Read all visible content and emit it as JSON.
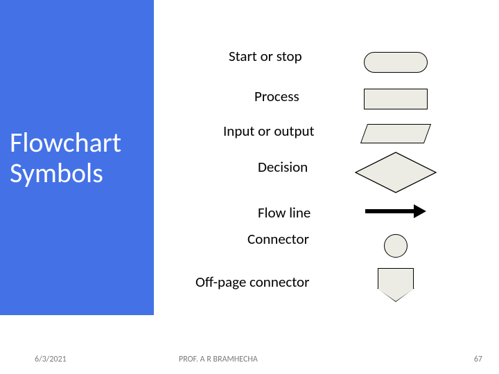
{
  "sidebar": {
    "title_line1": "Flowchart",
    "title_line2": "Symbols"
  },
  "symbols": [
    {
      "label": "Start or stop",
      "shape": "terminator"
    },
    {
      "label": "Process",
      "shape": "rectangle"
    },
    {
      "label": "Input or output",
      "shape": "parallelogram"
    },
    {
      "label": "Decision",
      "shape": "diamond"
    },
    {
      "label": "Flow line",
      "shape": "arrow"
    },
    {
      "label": "Connector",
      "shape": "circle"
    },
    {
      "label": "Off-page connector",
      "shape": "offpage"
    }
  ],
  "footer": {
    "date": "6/3/2021",
    "author": "PROF. A R BRAMHECHA",
    "page_number": "67"
  }
}
